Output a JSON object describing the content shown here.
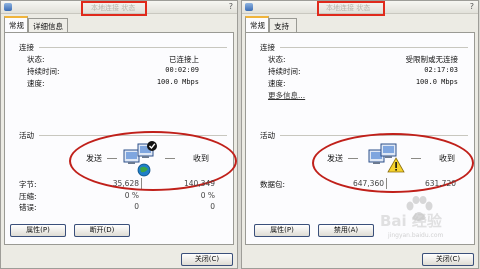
{
  "left": {
    "title": "本地连接 状态",
    "tabs": [
      "常规",
      "详细信息"
    ],
    "connection_section": "连接",
    "status_label": "状态:",
    "status_value": "已连接上",
    "duration_label": "持续时间:",
    "duration_value": "00:02:09",
    "speed_label": "速度:",
    "speed_value": "100.0 Mbps",
    "activity_section": "活动",
    "sent_label": "发送",
    "received_label": "收到",
    "bytes_label": "字节:",
    "bytes_sent": "35,628",
    "bytes_received": "140,349",
    "compression_label": "压缩:",
    "compression_sent": "0 %",
    "compression_received": "0 %",
    "errors_label": "错误:",
    "errors_sent": "0",
    "errors_received": "0",
    "properties_button": "属性(P)",
    "disable_button": "断开(D)",
    "close_button": "关闭(C)"
  },
  "right": {
    "title": "本地连接 状态",
    "tabs": [
      "常规",
      "支持"
    ],
    "connection_section": "连接",
    "status_label": "状态:",
    "status_value": "受限制或无连接",
    "duration_label": "持续时间:",
    "duration_value": "02:17:03",
    "speed_label": "速度:",
    "speed_value": "100.0 Mbps",
    "more_info_link": "更多信息...",
    "activity_section": "活动",
    "sent_label": "发送",
    "received_label": "收到",
    "packets_label": "数据包:",
    "packets_sent": "647,360",
    "packets_received": "631,720",
    "properties_button": "属性(P)",
    "disable_button": "禁用(A)",
    "close_button": "关闭(C)"
  },
  "watermark": {
    "brand": "Bai 经验",
    "url": "jingyan.baidu.com"
  },
  "colors": {
    "annotation_red": "#e02a1c",
    "active_tab_accent": "#f0b43c",
    "dialog_bg": "#ecebe4",
    "panel_bg": "#fcfcfe"
  },
  "icons": {
    "network_connected": "network-connected-icon",
    "network_limited": "network-warning-icon",
    "window": "window-icon",
    "help": "help-icon",
    "watermark_logo": "baidu-paw-icon"
  }
}
